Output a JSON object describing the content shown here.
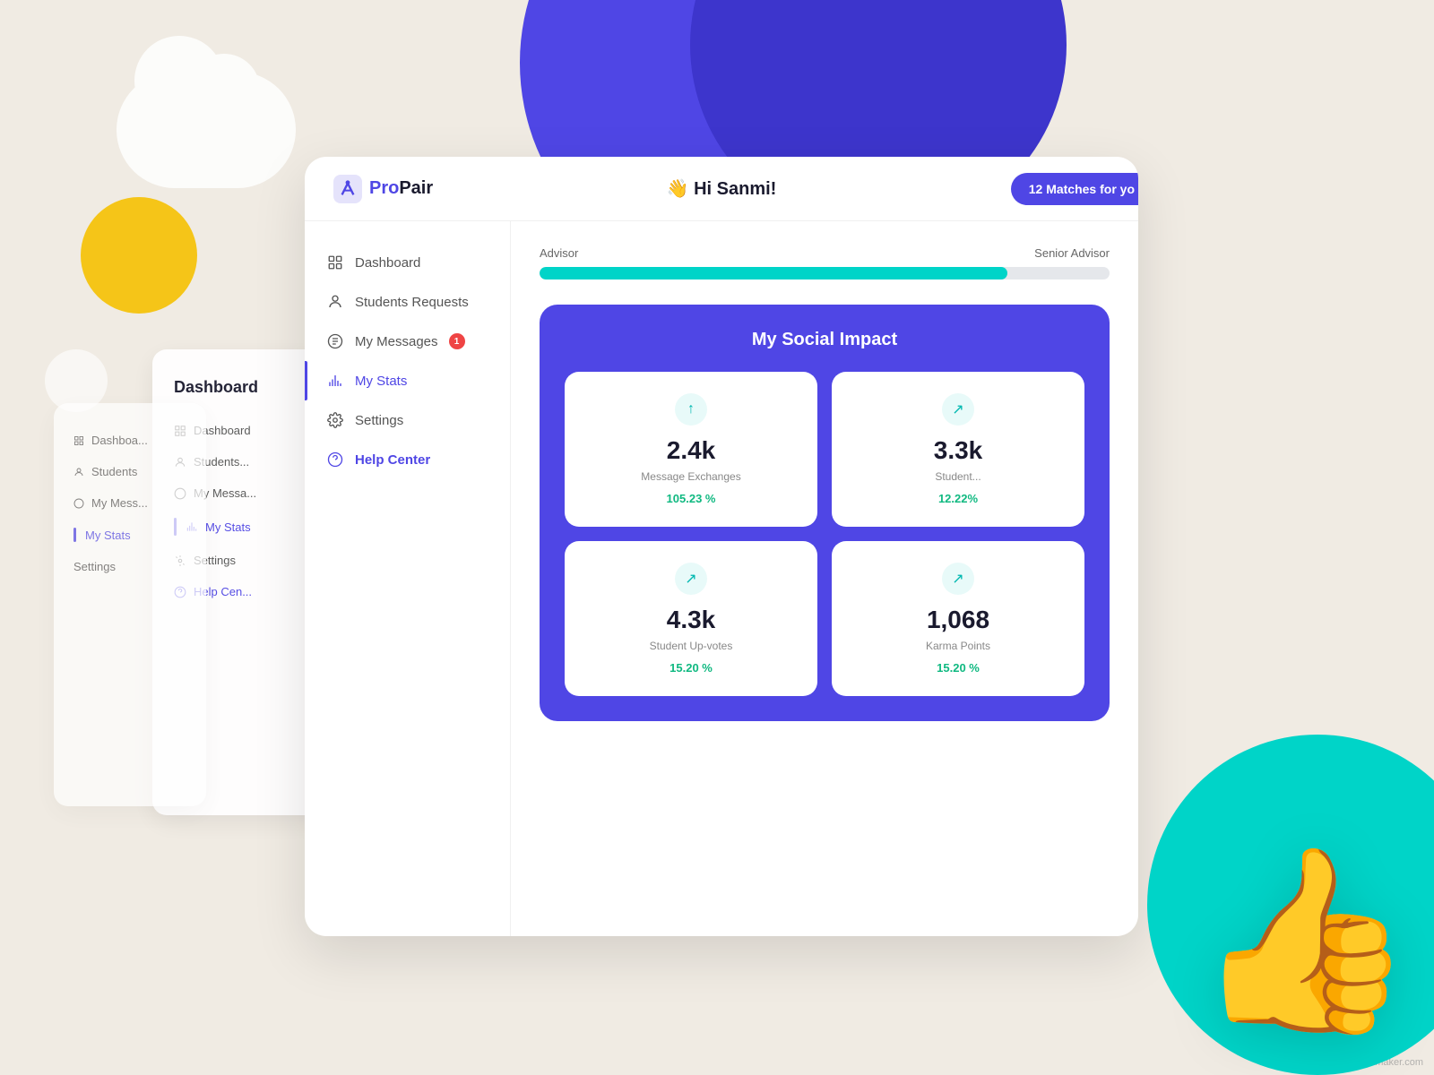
{
  "background": {
    "bg_color": "#f0ebe3"
  },
  "header": {
    "logo_name": "ProPair",
    "logo_pro": "Pro",
    "logo_pair": "Pair",
    "greeting_emoji": "👋",
    "greeting_text": "Hi Sanmi!",
    "matches_button": "12 Matches for yo"
  },
  "sidebar": {
    "items": [
      {
        "id": "dashboard",
        "label": "Dashboard",
        "active": false,
        "badge": null
      },
      {
        "id": "students-requests",
        "label": "Students Requests",
        "active": false,
        "badge": null
      },
      {
        "id": "my-messages",
        "label": "My Messages",
        "active": false,
        "badge": "1"
      },
      {
        "id": "my-stats",
        "label": "My Stats",
        "active": true,
        "badge": null
      },
      {
        "id": "settings",
        "label": "Settings",
        "active": false,
        "badge": null
      },
      {
        "id": "help-center",
        "label": "Help Center",
        "active": false,
        "badge": null,
        "highlight": true
      }
    ]
  },
  "main": {
    "progress": {
      "label_left": "Advisor",
      "label_right": "Senior Advisor",
      "fill_percent": 82
    },
    "social_impact": {
      "title": "My Social Impact",
      "stats": [
        {
          "value": "2.4k",
          "label": "Message Exchanges",
          "change": "105.23 %",
          "arrow_dir": "up"
        },
        {
          "value": "3.3k",
          "label": "Student...",
          "change": "12.22%",
          "arrow_dir": "up-right"
        },
        {
          "value": "4.3k",
          "label": "Student Up-votes",
          "change": "15.20 %",
          "arrow_dir": "up-right"
        },
        {
          "value": "1,068",
          "label": "Karma Points",
          "change": "15.20 %",
          "arrow_dir": "up-right"
        }
      ]
    }
  },
  "shadow_panels": {
    "title": "Dashboard",
    "items": [
      {
        "label": "Dashboard",
        "active": false
      },
      {
        "label": "Students Request",
        "active": false
      },
      {
        "label": "My Messa...",
        "active": false
      },
      {
        "label": "My Stats",
        "active": true
      },
      {
        "label": "Settings",
        "active": false
      },
      {
        "label": "Help Cen...",
        "active": false,
        "highlight": true
      }
    ]
  },
  "watermark": "post of uimaker.com"
}
